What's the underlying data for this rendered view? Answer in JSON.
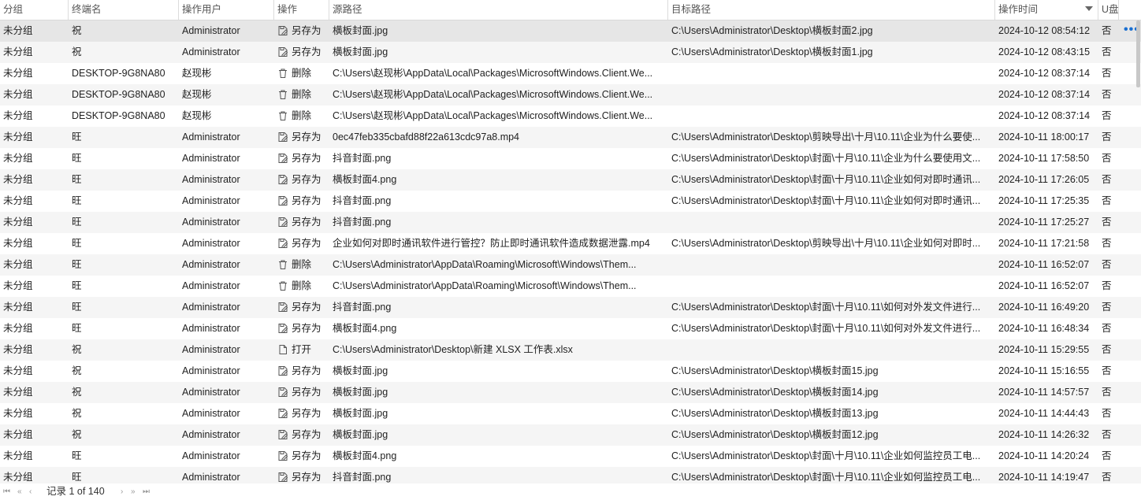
{
  "columns": {
    "group": "分组",
    "terminal": "终端名",
    "user": "操作用户",
    "op": "操作",
    "src": "源路径",
    "dst": "目标路径",
    "time": "操作时间",
    "usb": "U盘"
  },
  "rows": [
    {
      "group": "未分组",
      "terminal": "祝",
      "user": "Administrator",
      "op_icon": "save-as-icon",
      "op": "另存为",
      "src": "横板封面.jpg",
      "dst": "C:\\Users\\Administrator\\Desktop\\横板封面2.jpg",
      "time": "2024-10-12 08:54:12",
      "usb": "否"
    },
    {
      "group": "未分组",
      "terminal": "祝",
      "user": "Administrator",
      "op_icon": "save-as-icon",
      "op": "另存为",
      "src": "横板封面.jpg",
      "dst": "C:\\Users\\Administrator\\Desktop\\横板封面1.jpg",
      "time": "2024-10-12 08:43:15",
      "usb": "否"
    },
    {
      "group": "未分组",
      "terminal": "DESKTOP-9G8NA80",
      "user": "赵现彬",
      "op_icon": "trash-icon",
      "op": "删除",
      "src": "C:\\Users\\赵现彬\\AppData\\Local\\Packages\\MicrosoftWindows.Client.We...",
      "dst": "",
      "time": "2024-10-12 08:37:14",
      "usb": "否"
    },
    {
      "group": "未分组",
      "terminal": "DESKTOP-9G8NA80",
      "user": "赵现彬",
      "op_icon": "trash-icon",
      "op": "删除",
      "src": "C:\\Users\\赵现彬\\AppData\\Local\\Packages\\MicrosoftWindows.Client.We...",
      "dst": "",
      "time": "2024-10-12 08:37:14",
      "usb": "否"
    },
    {
      "group": "未分组",
      "terminal": "DESKTOP-9G8NA80",
      "user": "赵现彬",
      "op_icon": "trash-icon",
      "op": "删除",
      "src": "C:\\Users\\赵现彬\\AppData\\Local\\Packages\\MicrosoftWindows.Client.We...",
      "dst": "",
      "time": "2024-10-12 08:37:14",
      "usb": "否"
    },
    {
      "group": "未分组",
      "terminal": "旺",
      "user": "Administrator",
      "op_icon": "save-as-icon",
      "op": "另存为",
      "src": "0ec47feb335cbafd88f22a613cdc97a8.mp4",
      "dst": "C:\\Users\\Administrator\\Desktop\\剪映导出\\十月\\10.11\\企业为什么要使...",
      "time": "2024-10-11 18:00:17",
      "usb": "否"
    },
    {
      "group": "未分组",
      "terminal": "旺",
      "user": "Administrator",
      "op_icon": "save-as-icon",
      "op": "另存为",
      "src": "抖音封面.png",
      "dst": "C:\\Users\\Administrator\\Desktop\\封面\\十月\\10.11\\企业为什么要使用文...",
      "time": "2024-10-11 17:58:50",
      "usb": "否"
    },
    {
      "group": "未分组",
      "terminal": "旺",
      "user": "Administrator",
      "op_icon": "save-as-icon",
      "op": "另存为",
      "src": "横板封面4.png",
      "dst": "C:\\Users\\Administrator\\Desktop\\封面\\十月\\10.11\\企业如何对即时通讯...",
      "time": "2024-10-11 17:26:05",
      "usb": "否"
    },
    {
      "group": "未分组",
      "terminal": "旺",
      "user": "Administrator",
      "op_icon": "save-as-icon",
      "op": "另存为",
      "src": "抖音封面.png",
      "dst": "C:\\Users\\Administrator\\Desktop\\封面\\十月\\10.11\\企业如何对即时通讯...",
      "time": "2024-10-11 17:25:35",
      "usb": "否"
    },
    {
      "group": "未分组",
      "terminal": "旺",
      "user": "Administrator",
      "op_icon": "save-as-icon",
      "op": "另存为",
      "src": "抖音封面.png",
      "dst": "",
      "time": "2024-10-11 17:25:27",
      "usb": "否"
    },
    {
      "group": "未分组",
      "terminal": "旺",
      "user": "Administrator",
      "op_icon": "save-as-icon",
      "op": "另存为",
      "src": "企业如何对即时通讯软件进行管控？防止即时通讯软件造成数据泄露.mp4",
      "dst": "C:\\Users\\Administrator\\Desktop\\剪映导出\\十月\\10.11\\企业如何对即时...",
      "time": "2024-10-11 17:21:58",
      "usb": "否"
    },
    {
      "group": "未分组",
      "terminal": "旺",
      "user": "Administrator",
      "op_icon": "trash-icon",
      "op": "删除",
      "src": "C:\\Users\\Administrator\\AppData\\Roaming\\Microsoft\\Windows\\Them...",
      "dst": "",
      "time": "2024-10-11 16:52:07",
      "usb": "否"
    },
    {
      "group": "未分组",
      "terminal": "旺",
      "user": "Administrator",
      "op_icon": "trash-icon",
      "op": "删除",
      "src": "C:\\Users\\Administrator\\AppData\\Roaming\\Microsoft\\Windows\\Them...",
      "dst": "",
      "time": "2024-10-11 16:52:07",
      "usb": "否"
    },
    {
      "group": "未分组",
      "terminal": "旺",
      "user": "Administrator",
      "op_icon": "save-as-icon",
      "op": "另存为",
      "src": "抖音封面.png",
      "dst": "C:\\Users\\Administrator\\Desktop\\封面\\十月\\10.11\\如何对外发文件进行...",
      "time": "2024-10-11 16:49:20",
      "usb": "否"
    },
    {
      "group": "未分组",
      "terminal": "旺",
      "user": "Administrator",
      "op_icon": "save-as-icon",
      "op": "另存为",
      "src": "横板封面4.png",
      "dst": "C:\\Users\\Administrator\\Desktop\\封面\\十月\\10.11\\如何对外发文件进行...",
      "time": "2024-10-11 16:48:34",
      "usb": "否"
    },
    {
      "group": "未分组",
      "terminal": "祝",
      "user": "Administrator",
      "op_icon": "file-icon",
      "op": "打开",
      "src": "C:\\Users\\Administrator\\Desktop\\新建 XLSX 工作表.xlsx",
      "dst": "",
      "time": "2024-10-11 15:29:55",
      "usb": "否"
    },
    {
      "group": "未分组",
      "terminal": "祝",
      "user": "Administrator",
      "op_icon": "save-as-icon",
      "op": "另存为",
      "src": "横板封面.jpg",
      "dst": "C:\\Users\\Administrator\\Desktop\\横板封面15.jpg",
      "time": "2024-10-11 15:16:55",
      "usb": "否"
    },
    {
      "group": "未分组",
      "terminal": "祝",
      "user": "Administrator",
      "op_icon": "save-as-icon",
      "op": "另存为",
      "src": "横板封面.jpg",
      "dst": "C:\\Users\\Administrator\\Desktop\\横板封面14.jpg",
      "time": "2024-10-11 14:57:57",
      "usb": "否"
    },
    {
      "group": "未分组",
      "terminal": "祝",
      "user": "Administrator",
      "op_icon": "save-as-icon",
      "op": "另存为",
      "src": "横板封面.jpg",
      "dst": "C:\\Users\\Administrator\\Desktop\\横板封面13.jpg",
      "time": "2024-10-11 14:44:43",
      "usb": "否"
    },
    {
      "group": "未分组",
      "terminal": "祝",
      "user": "Administrator",
      "op_icon": "save-as-icon",
      "op": "另存为",
      "src": "横板封面.jpg",
      "dst": "C:\\Users\\Administrator\\Desktop\\横板封面12.jpg",
      "time": "2024-10-11 14:26:32",
      "usb": "否"
    },
    {
      "group": "未分组",
      "terminal": "旺",
      "user": "Administrator",
      "op_icon": "save-as-icon",
      "op": "另存为",
      "src": "横板封面4.png",
      "dst": "C:\\Users\\Administrator\\Desktop\\封面\\十月\\10.11\\企业如何监控员工电...",
      "time": "2024-10-11 14:20:24",
      "usb": "否"
    },
    {
      "group": "未分组",
      "terminal": "旺",
      "user": "Administrator",
      "op_icon": "save-as-icon",
      "op": "另存为",
      "src": "抖音封面.png",
      "dst": "C:\\Users\\Administrator\\Desktop\\封面\\十月\\10.11\\企业如何监控员工电...",
      "time": "2024-10-11 14:19:47",
      "usb": "否"
    }
  ],
  "footer": {
    "record_text": "记录 1 of 140"
  },
  "colors": {
    "selected_row": "#e6e6e6",
    "alt_row": "#f5f5f5",
    "accent": "#1a6fd1"
  }
}
